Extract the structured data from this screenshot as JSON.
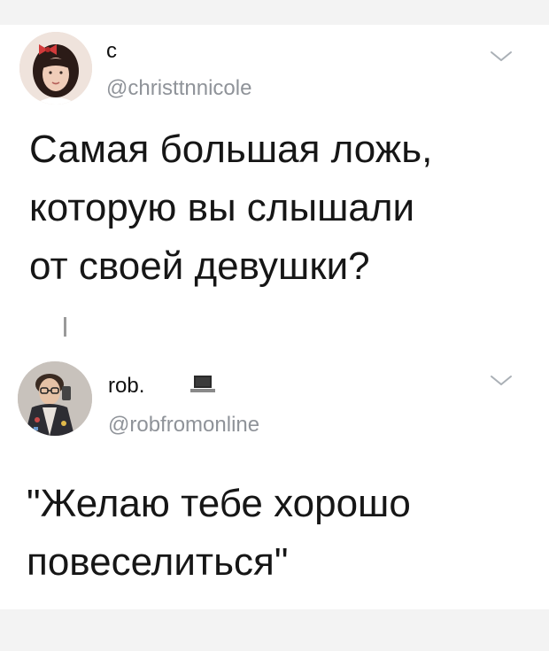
{
  "tweets": [
    {
      "display_name": "с",
      "handle": "@christtnnicole",
      "text": "Самая большая ложь,\nкоторую вы слышали\nот своей девушки?",
      "avatar_icon": "profile-photo-girl",
      "menu_icon": "chevron-down-icon"
    },
    {
      "display_name": "rob.",
      "name_emoji": "laptop-icon",
      "handle": "@robfromonline",
      "text": "\"Желаю тебе хорошо\nповеселиться\"",
      "avatar_icon": "profile-photo-boy",
      "menu_icon": "chevron-down-icon"
    }
  ],
  "colors": {
    "handle": "#8f9399",
    "text": "#161616",
    "chevron": "#aab0b6",
    "strip": "#f3f3f3"
  }
}
